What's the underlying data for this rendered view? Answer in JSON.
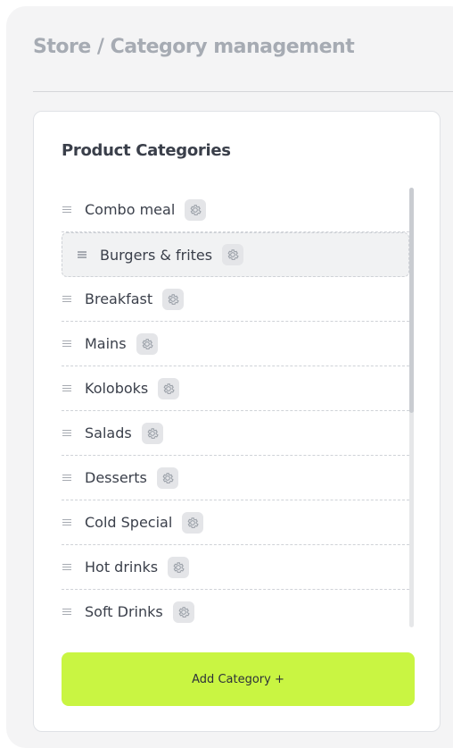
{
  "breadcrumb": "Store / Category management",
  "card": {
    "title": "Product Categories",
    "items": [
      {
        "label": "Combo meal",
        "nested": false
      },
      {
        "label": "Burgers & frites",
        "nested": true
      },
      {
        "label": "Breakfast",
        "nested": false
      },
      {
        "label": "Mains",
        "nested": false
      },
      {
        "label": "Koloboks",
        "nested": false
      },
      {
        "label": "Salads",
        "nested": false
      },
      {
        "label": "Desserts",
        "nested": false
      },
      {
        "label": "Cold Special",
        "nested": false
      },
      {
        "label": "Hot drinks",
        "nested": false
      },
      {
        "label": "Soft Drinks",
        "nested": false
      }
    ],
    "add_button_label": "Add Category +"
  },
  "icons": {
    "drag": "drag-handle-icon",
    "settings": "gear-icon"
  },
  "colors": {
    "accent": "#c9f542",
    "panel_bg": "#f4f4f5",
    "text": "#3a3f4a",
    "muted": "#a6abb3"
  }
}
